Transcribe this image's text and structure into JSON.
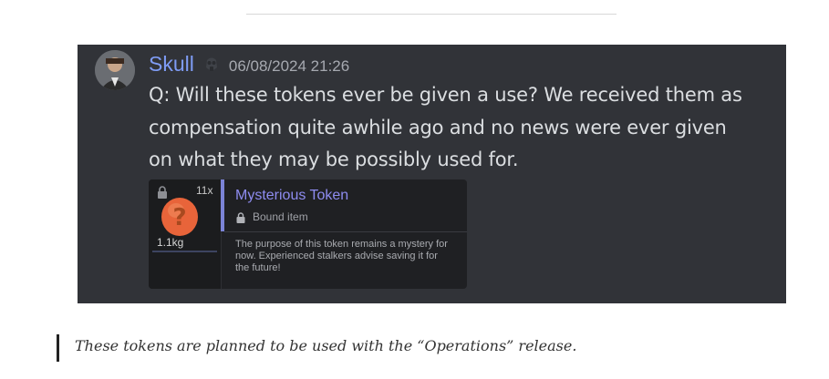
{
  "message": {
    "username": "Skull",
    "timestamp": "06/08/2024 21:26",
    "text": "Q: Will these tokens ever be given a use? We received them as compensation quite awhile ago and no news were ever given on what they may be possibly used for."
  },
  "item_card": {
    "count": "11x",
    "weight": "1.1kg",
    "name": "Mysterious Token",
    "bound_label": "Bound item",
    "description": "The purpose of this token remains a mystery for now. Experienced stalkers advise saving it for the future!"
  },
  "answer": {
    "text": "These tokens are planned to be used with the “Operations”  release."
  },
  "colors": {
    "card_bg": "#313338",
    "username": "#7f9cf5",
    "item_name": "#8e8cf0",
    "token_orange": "#e8643a"
  }
}
